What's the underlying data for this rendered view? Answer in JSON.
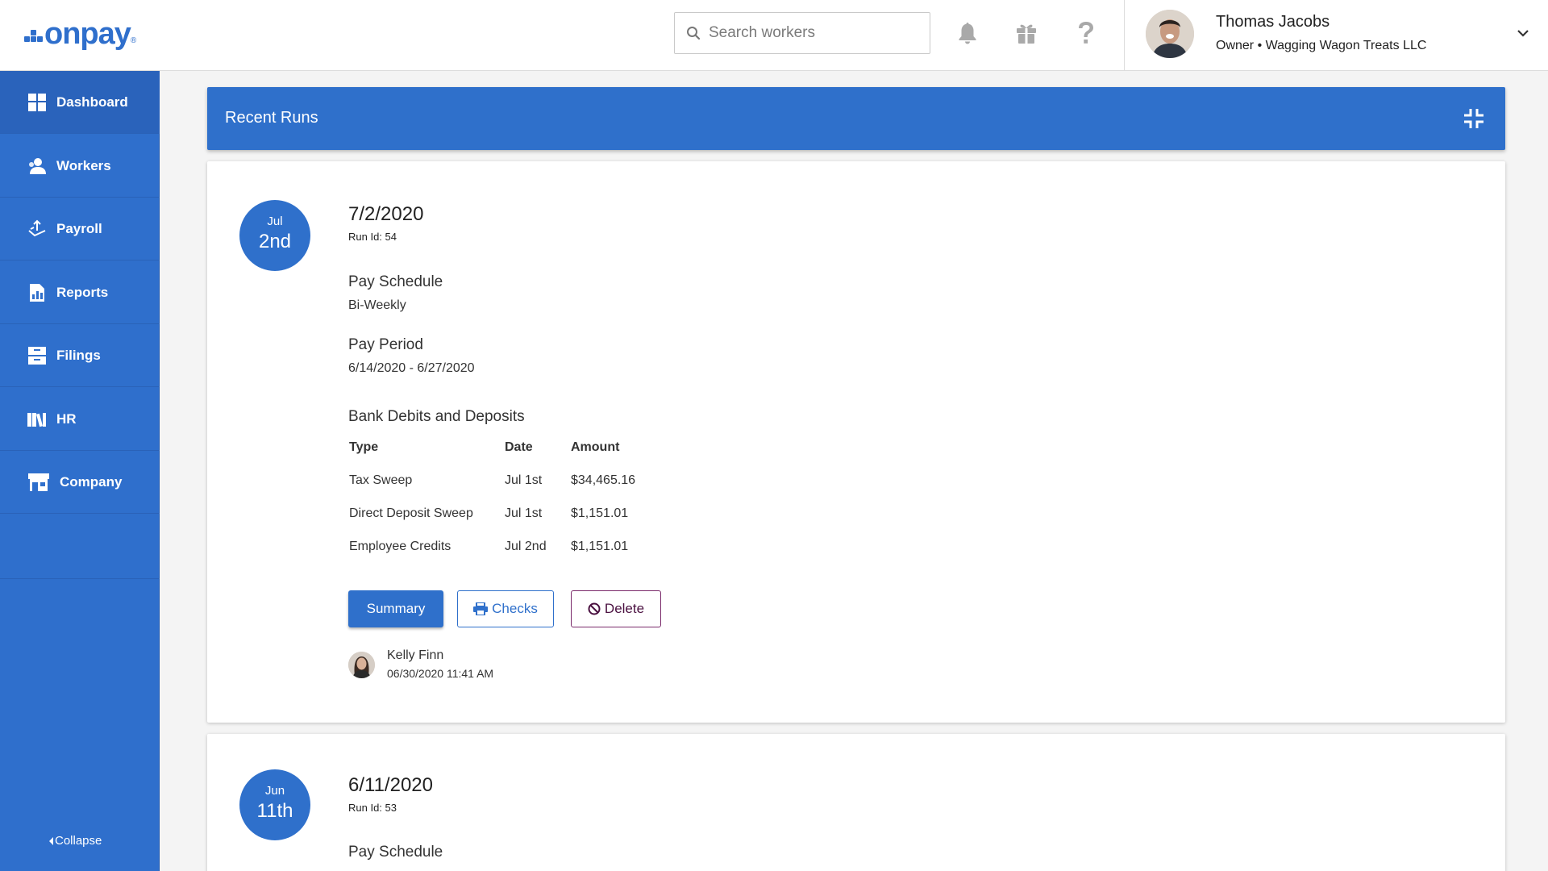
{
  "brand": {
    "name": "onpay",
    "accent": "#2f6fcc"
  },
  "header": {
    "search": {
      "placeholder": "Search workers"
    },
    "icons": [
      "bell-icon",
      "gift-icon",
      "help-icon"
    ],
    "user": {
      "name": "Thomas Jacobs",
      "role": "Owner • Wagging Wagon Treats LLC"
    }
  },
  "sidebar": {
    "items": [
      {
        "label": "Dashboard",
        "icon": "dashboard-icon"
      },
      {
        "label": "Workers",
        "icon": "workers-icon"
      },
      {
        "label": "Payroll",
        "icon": "payroll-icon"
      },
      {
        "label": "Reports",
        "icon": "reports-icon"
      },
      {
        "label": "Filings",
        "icon": "filings-icon"
      },
      {
        "label": "HR",
        "icon": "hr-icon"
      },
      {
        "label": "Company",
        "icon": "company-icon"
      }
    ],
    "collapse_label": "Collapse"
  },
  "main": {
    "banner_title": "Recent Runs",
    "runs": [
      {
        "month": "Jul",
        "day": "2nd",
        "date": "7/2/2020",
        "run_id": "Run Id: 54",
        "pay_schedule_label": "Pay Schedule",
        "pay_schedule": "Bi-Weekly",
        "pay_period_label": "Pay Period",
        "pay_period": "6/14/2020 - 6/27/2020",
        "bank_label": "Bank Debits and Deposits",
        "columns": [
          "Type",
          "Date",
          "Amount"
        ],
        "rows": [
          [
            "Tax Sweep",
            "Jul 1st",
            "$34,465.16"
          ],
          [
            "Direct Deposit Sweep",
            "Jul 1st",
            "$1,151.01"
          ],
          [
            "Employee Credits",
            "Jul 2nd",
            "$1,151.01"
          ]
        ],
        "buttons": {
          "summary": "Summary",
          "checks": "Checks",
          "delete": "Delete"
        },
        "created_by": "Kelly Finn",
        "created_at": "06/30/2020 11:41 AM"
      },
      {
        "month": "Jun",
        "day": "11th",
        "date": "6/11/2020",
        "run_id": "Run Id: 53",
        "pay_schedule_label": "Pay Schedule"
      }
    ]
  }
}
